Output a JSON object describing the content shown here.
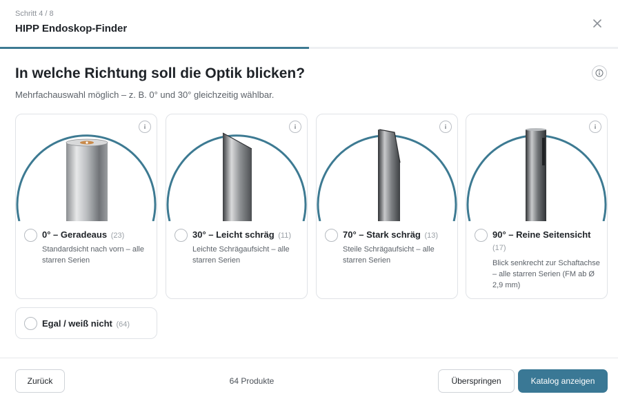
{
  "header": {
    "step": "Schritt 4 / 8",
    "title": "HIPP Endoskop-Finder",
    "close_icon": "close-icon",
    "progress_fraction": 0.5
  },
  "question": {
    "title": "In welche Richtung soll die Optik blicken?",
    "subtitle": "Mehrfachauswahl möglich – z. B. 0° und 30° gleichzeitig wählbar.",
    "info_icon": "info-icon"
  },
  "options": [
    {
      "label": "0° – Geradeaus",
      "count": "(23)",
      "desc": "Standardsicht nach vorn – alle starren Serien"
    },
    {
      "label": "30° – Leicht schräg",
      "count": "(11)",
      "desc": "Leichte Schrägaufsicht – alle starren Serien"
    },
    {
      "label": "70° – Stark schräg",
      "count": "(13)",
      "desc": "Steile Schrägaufsicht – alle starren Serien"
    },
    {
      "label": "90° – Reine Seitensicht",
      "count": "(17)",
      "desc": "Blick senkrecht zur Schaftachse – alle starren Serien (FM ab Ø 2,9 mm)"
    }
  ],
  "egal": {
    "label": "Egal / weiß nicht",
    "count": "(64)"
  },
  "footer": {
    "back": "Zurück",
    "products": "64 Produkte",
    "skip": "Überspringen",
    "catalog": "Katalog anzeigen"
  },
  "colors": {
    "accent": "#3a7895",
    "ring": "#3d7a92"
  }
}
